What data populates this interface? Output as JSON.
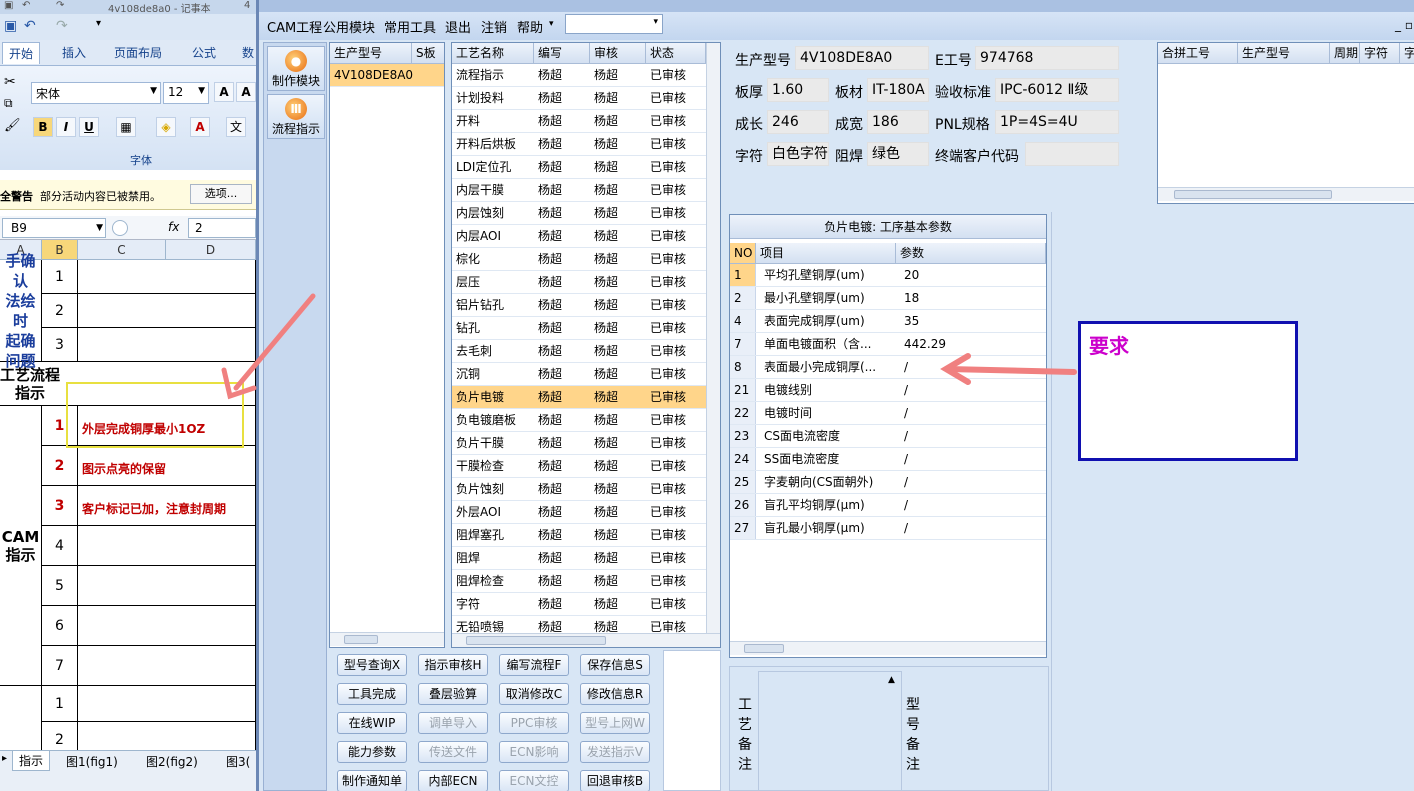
{
  "excel": {
    "title": "4v108de8a0 - 记事本",
    "title_right": "4",
    "tabs": [
      "开始",
      "插入",
      "页面布局",
      "公式",
      "数"
    ],
    "font_name": "宋体",
    "font_size": "12",
    "font_group_label": "字体",
    "security_label": "全警告",
    "security_msg": "部分活动内容已被禁用。",
    "options_button": "选项...",
    "name_box": "B9",
    "fx": "fx",
    "formula_value": "2",
    "col_headers": [
      "A",
      "B",
      "C",
      "D"
    ],
    "side_text_1": "手确认\n法绘时\n起确\n问题",
    "process_label": "工艺流程\n指示",
    "cam_label": "CAM\n指示",
    "row_numbers_top": [
      "1",
      "2",
      "3"
    ],
    "row_numbers_cam": [
      "1",
      "2",
      "3",
      "4",
      "5",
      "6",
      "7"
    ],
    "row_numbers_bottom": [
      "1",
      "2"
    ],
    "notes": [
      "外层完成铜厚最小1OZ",
      "图示点亮的保留",
      "客户标记已加，注意封周期"
    ],
    "sheet_tabs": [
      "指示",
      "图1(fig1)",
      "图2(fig2)",
      "图3("
    ]
  },
  "menu": {
    "items": [
      "CAM工程",
      "公用模块",
      "常用工具",
      "退出",
      "注销",
      "帮助"
    ],
    "combo_value": "",
    "win_ctrl": "_ ▫"
  },
  "nav": {
    "buttons": [
      "制作模块",
      "流程指示"
    ]
  },
  "model_list": {
    "headers": [
      "生产型号",
      "S板"
    ],
    "rows": [
      "4V108DE8A0"
    ]
  },
  "process_list": {
    "headers": [
      "工艺名称",
      "编写",
      "审核",
      "状态"
    ],
    "selected_index": 14,
    "rows": [
      [
        "流程指示",
        "杨超",
        "杨超",
        "已审核"
      ],
      [
        "计划投料",
        "杨超",
        "杨超",
        "已审核"
      ],
      [
        "开料",
        "杨超",
        "杨超",
        "已审核"
      ],
      [
        "开料后烘板",
        "杨超",
        "杨超",
        "已审核"
      ],
      [
        "LDI定位孔",
        "杨超",
        "杨超",
        "已审核"
      ],
      [
        "内层干膜",
        "杨超",
        "杨超",
        "已审核"
      ],
      [
        "内层蚀刻",
        "杨超",
        "杨超",
        "已审核"
      ],
      [
        "内层AOI",
        "杨超",
        "杨超",
        "已审核"
      ],
      [
        "棕化",
        "杨超",
        "杨超",
        "已审核"
      ],
      [
        "层压",
        "杨超",
        "杨超",
        "已审核"
      ],
      [
        "铝片钻孔",
        "杨超",
        "杨超",
        "已审核"
      ],
      [
        "钻孔",
        "杨超",
        "杨超",
        "已审核"
      ],
      [
        "去毛刺",
        "杨超",
        "杨超",
        "已审核"
      ],
      [
        "沉铜",
        "杨超",
        "杨超",
        "已审核"
      ],
      [
        "负片电镀",
        "杨超",
        "杨超",
        "已审核"
      ],
      [
        "负电镀磨板",
        "杨超",
        "杨超",
        "已审核"
      ],
      [
        "负片干膜",
        "杨超",
        "杨超",
        "已审核"
      ],
      [
        "干膜检查",
        "杨超",
        "杨超",
        "已审核"
      ],
      [
        "负片蚀刻",
        "杨超",
        "杨超",
        "已审核"
      ],
      [
        "外层AOI",
        "杨超",
        "杨超",
        "已审核"
      ],
      [
        "阻焊塞孔",
        "杨超",
        "杨超",
        "已审核"
      ],
      [
        "阻焊",
        "杨超",
        "杨超",
        "已审核"
      ],
      [
        "阻焊检查",
        "杨超",
        "杨超",
        "已审核"
      ],
      [
        "字符",
        "杨超",
        "杨超",
        "已审核"
      ],
      [
        "无铅喷锡",
        "杨超",
        "杨超",
        "已审核"
      ]
    ]
  },
  "actions": [
    {
      "label": "型号查询X",
      "enabled": true
    },
    {
      "label": "指示审核H",
      "enabled": true
    },
    {
      "label": "编写流程F",
      "enabled": true
    },
    {
      "label": "保存信息S",
      "enabled": true
    },
    {
      "label": "工具完成",
      "enabled": true
    },
    {
      "label": "叠层验算",
      "enabled": true
    },
    {
      "label": "取消修改C",
      "enabled": true
    },
    {
      "label": "修改信息R",
      "enabled": true
    },
    {
      "label": "在线WIP",
      "enabled": true
    },
    {
      "label": "调单导入",
      "enabled": false
    },
    {
      "label": "PPC审核",
      "enabled": false
    },
    {
      "label": "型号上网W",
      "enabled": false
    },
    {
      "label": "能力参数",
      "enabled": true
    },
    {
      "label": "传送文件",
      "enabled": false
    },
    {
      "label": "ECN影响",
      "enabled": false
    },
    {
      "label": "发送指示V",
      "enabled": false
    },
    {
      "label": "制作通知单",
      "enabled": true
    },
    {
      "label": "内部ECN",
      "enabled": true
    },
    {
      "label": "ECN文控",
      "enabled": false
    },
    {
      "label": "回退审核B",
      "enabled": true
    }
  ],
  "info": {
    "prod_model_label": "生产型号",
    "prod_model": "4V108DE8A0",
    "e_no_label": "E工号",
    "e_no": "974768",
    "thickness_label": "板厚",
    "thickness": "1.60",
    "material_label": "板材",
    "material": "IT-180A",
    "standard_label": "验收标准",
    "standard": "IPC-6012 Ⅱ级",
    "length_label": "成长",
    "length": "246",
    "width_label": "成宽",
    "width": "186",
    "pnl_label": "PNL规格",
    "pnl": "1P=4S=4U",
    "char_label": "字符",
    "char": "白色字符",
    "mask_label": "阻焊",
    "mask": "绿色",
    "customer_label": "终端客户代码",
    "customer": ""
  },
  "merge_grid": {
    "headers": [
      "合拼工号",
      "生产型号",
      "周期",
      "字符",
      "字"
    ]
  },
  "param_grid": {
    "title": "负片电镀: 工序基本参数",
    "headers": [
      "NO",
      "项目",
      "参数"
    ],
    "rows": [
      [
        "1",
        "平均孔壁铜厚(um)",
        "20"
      ],
      [
        "2",
        "最小孔壁铜厚(um)",
        "18"
      ],
      [
        "4",
        "表面完成铜厚(um)",
        "35"
      ],
      [
        "7",
        "单面电镀面积（含...",
        "442.29"
      ],
      [
        "8",
        "表面最小完成铜厚(...",
        "/"
      ],
      [
        "21",
        "电镀线别",
        "/"
      ],
      [
        "22",
        "电镀时间",
        "/"
      ],
      [
        "23",
        "CS面电流密度",
        "/"
      ],
      [
        "24",
        "SS面电流密度",
        "/"
      ],
      [
        "25",
        "字麦朝向(CS面朝外)",
        "/"
      ],
      [
        "26",
        "盲孔平均铜厚(μm)",
        "/"
      ],
      [
        "27",
        "盲孔最小铜厚(μm)",
        "/"
      ]
    ]
  },
  "remarks": {
    "process_remark_label": "工艺备注",
    "model_remark_label": "型号备注"
  },
  "annotation": {
    "callout_text": "要求",
    "arrow_color": "#f08080",
    "box_color": "#1010b0",
    "text_color": "#cc00cc"
  }
}
